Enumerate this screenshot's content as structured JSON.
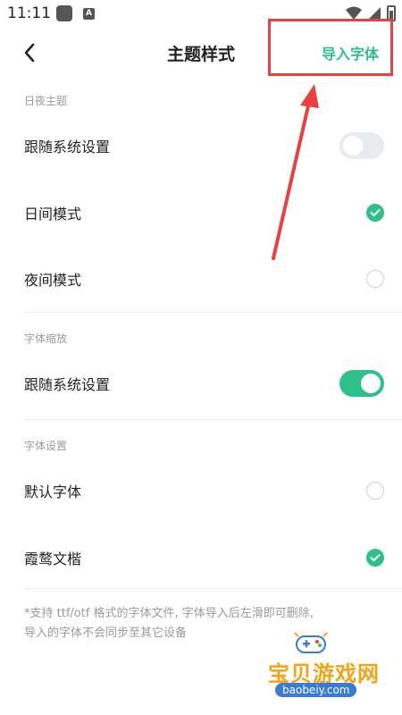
{
  "status_bar": {
    "time": "11:11",
    "icons": [
      "app-icon",
      "a-icon",
      "wifi-icon",
      "signal-icon",
      "battery-icon"
    ]
  },
  "nav": {
    "back_icon": "chevron-left-icon",
    "title": "主题样式",
    "import_font_label": "导入字体"
  },
  "annotation": {
    "highlight_color": "#e8413f"
  },
  "sections": {
    "day_night": {
      "header": "日夜主题",
      "follow_system_label": "跟随系统设置",
      "follow_system_on": false,
      "day_mode_label": "日间模式",
      "day_mode_selected": true,
      "night_mode_label": "夜间模式",
      "night_mode_selected": false
    },
    "font_scale": {
      "header": "字体缩放",
      "follow_system_label": "跟随系统设置",
      "follow_system_on": true
    },
    "font_settings": {
      "header": "字体设置",
      "default_font_label": "默认字体",
      "default_font_selected": false,
      "wenkai_label": "霞鹜文楷",
      "wenkai_selected": true
    }
  },
  "footnote": {
    "line1": "*支持 ttf/otf 格式的字体文件, 字体导入后左滑即可删除,",
    "line2": "导入的字体不会同步至其它设备"
  },
  "watermark": {
    "title": "宝贝游戏网",
    "url": "baobeiy.com"
  },
  "colors": {
    "accent": "#2fc08a",
    "toggle_off": "#e9ecef",
    "secondary_text": "#9a9a9a",
    "annotation": "#e8413f"
  }
}
